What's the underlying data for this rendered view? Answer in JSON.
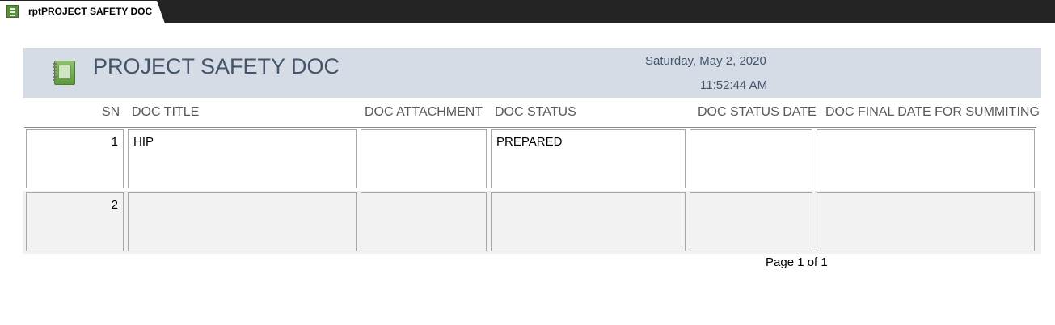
{
  "tab": {
    "label": "rptPROJECT SAFETY DOC"
  },
  "header": {
    "title": "PROJECT SAFETY DOC",
    "date": "Saturday, May 2, 2020",
    "time": "11:52:44 AM"
  },
  "columns": [
    "SN",
    "DOC TITLE",
    "DOC ATTACHMENT",
    "DOC STATUS",
    "DOC STATUS DATE",
    "DOC FINAL DATE FOR SUMMITING"
  ],
  "rows": [
    {
      "sn": "1",
      "title": "HIP",
      "attachment": "",
      "status": "PREPARED",
      "status_date": "",
      "final_date": ""
    },
    {
      "sn": "2",
      "title": "",
      "attachment": "",
      "status": "",
      "status_date": "",
      "final_date": ""
    }
  ],
  "footer": {
    "page": "Page 1 of 1"
  },
  "colors": {
    "header_band": "#d6dce5",
    "title_text": "#44546a",
    "alt_row": "#f2f2f2",
    "tab_bar": "#232323"
  }
}
